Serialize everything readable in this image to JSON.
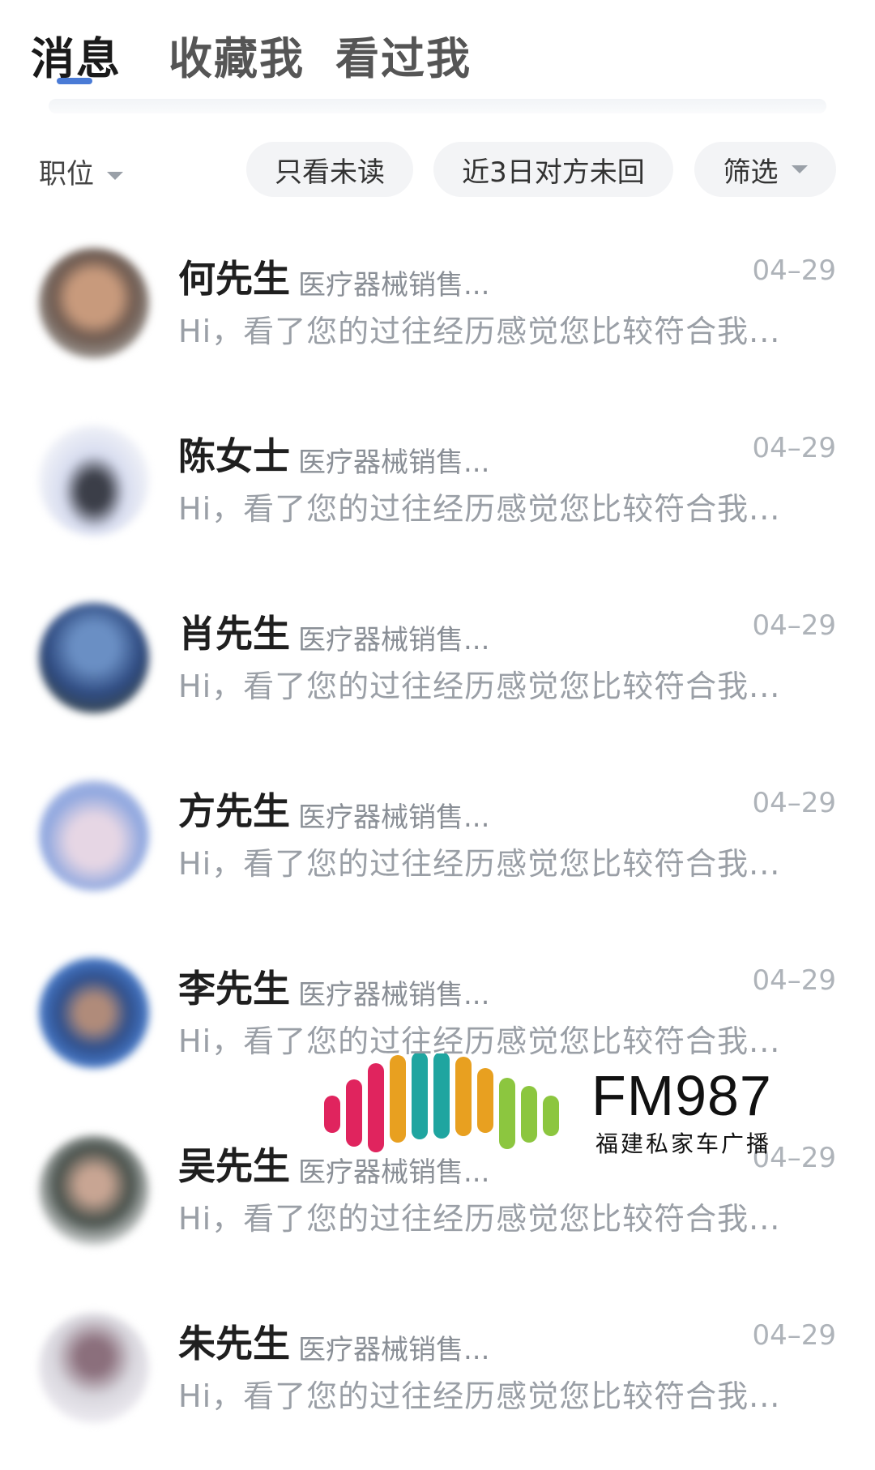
{
  "tabs": [
    {
      "label": "消息",
      "active": true
    },
    {
      "label": "收藏我",
      "active": false
    },
    {
      "label": "看过我",
      "active": false
    }
  ],
  "filters": {
    "position_label": "职位",
    "chips": [
      "只看未读",
      "近3日对方未回",
      "筛选"
    ]
  },
  "messages": [
    {
      "name": "何先生",
      "job": "医疗器械销售...",
      "date": "04–29",
      "preview": "Hi，看了您的过往经历感觉您比较符合我..."
    },
    {
      "name": "陈女士",
      "job": "医疗器械销售...",
      "date": "04–29",
      "preview": "Hi，看了您的过往经历感觉您比较符合我..."
    },
    {
      "name": "肖先生",
      "job": "医疗器械销售...",
      "date": "04–29",
      "preview": "Hi，看了您的过往经历感觉您比较符合我..."
    },
    {
      "name": "方先生",
      "job": "医疗器械销售...",
      "date": "04–29",
      "preview": "Hi，看了您的过往经历感觉您比较符合我..."
    },
    {
      "name": "李先生",
      "job": "医疗器械销售...",
      "date": "04–29",
      "preview": "Hi，看了您的过往经历感觉您比较符合我..."
    },
    {
      "name": "吴先生",
      "job": "医疗器械销售...",
      "date": "04–29",
      "preview": "Hi，看了您的过往经历感觉您比较符合我..."
    },
    {
      "name": "朱先生",
      "job": "医疗器械销售...",
      "date": "04–29",
      "preview": "Hi，看了您的过往经历感觉您比较符合我..."
    }
  ],
  "watermark": {
    "title": "FM987",
    "subtitle": "福建私家车广播"
  },
  "colors": {
    "accent": "#4a7bd6",
    "chip_bg": "#f3f4f6"
  }
}
